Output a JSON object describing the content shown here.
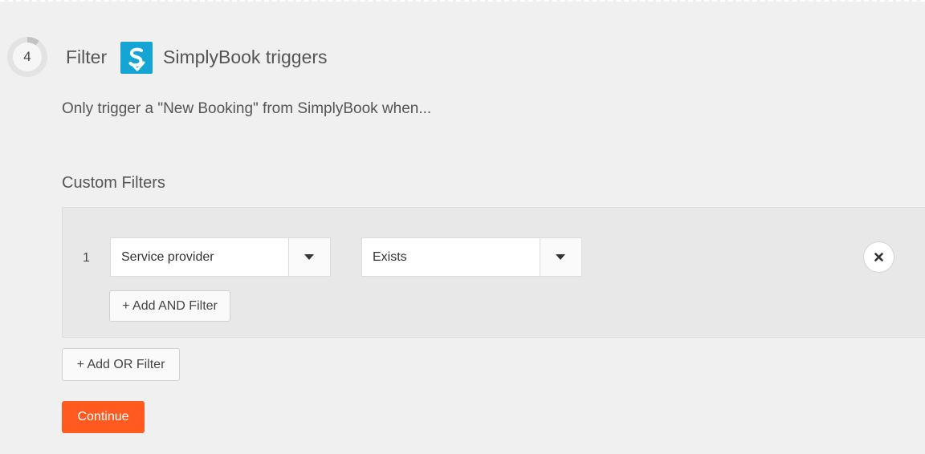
{
  "step": {
    "number": "4",
    "label": "Filter",
    "app_name": "SimplyBook triggers",
    "progress_fraction": 0.1
  },
  "subtitle": "Only trigger a \"New Booking\" from SimplyBook when...",
  "custom_filters": {
    "title": "Custom Filters",
    "rows": [
      {
        "number": "1",
        "field": "Service provider",
        "condition": "Exists"
      }
    ],
    "add_and_label": "+ Add AND Filter",
    "add_or_label": "+ Add OR Filter"
  },
  "continue_label": "Continue",
  "colors": {
    "background": "#f0f0f0",
    "accent_orange": "#ff5a1f",
    "app_logo_blue": "#15a5d4",
    "panel": "#e8e8e8"
  },
  "icons": {
    "app_logo": "simplybook-logo-icon",
    "dropdown": "caret-down-icon",
    "remove": "close-icon"
  }
}
